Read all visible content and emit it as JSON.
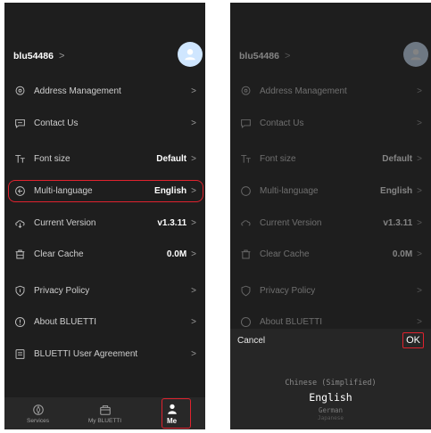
{
  "profile": {
    "username": "blu54486",
    "chevron": ">"
  },
  "menu": [
    {
      "label": "Address Management",
      "value": "",
      "icon": "location-pin-icon"
    },
    {
      "label": "Contact Us",
      "value": "",
      "icon": "chat-bubble-icon"
    },
    {
      "label": "Font size",
      "value": "Default",
      "icon": "font-size-icon"
    },
    {
      "label": "Multi-language",
      "value": "English",
      "icon": "language-icon"
    },
    {
      "label": "Current Version",
      "value": "v1.3.11",
      "icon": "cloud-download-icon"
    },
    {
      "label": "Clear Cache",
      "value": "0.0M",
      "icon": "trash-icon"
    },
    {
      "label": "Privacy Policy",
      "value": "",
      "icon": "shield-icon"
    },
    {
      "label": "About BLUETTI",
      "value": "",
      "icon": "info-icon"
    },
    {
      "label": "BLUETTI User Agreement",
      "value": "",
      "icon": "document-icon"
    }
  ],
  "tabs": [
    {
      "label": "Services",
      "icon": "compass-icon"
    },
    {
      "label": "My BLUETTI",
      "icon": "device-icon"
    },
    {
      "label": "Me",
      "icon": "user-icon"
    }
  ],
  "picker": {
    "cancel": "Cancel",
    "ok": "OK",
    "options": [
      "Chinese (Simplified)",
      "English",
      "German",
      "Japanese"
    ],
    "selected": "English"
  },
  "colors": {
    "background": "#1e1e1e",
    "highlight": "#e0222e",
    "avatar": "#cfe6ff"
  },
  "chevron": ">"
}
